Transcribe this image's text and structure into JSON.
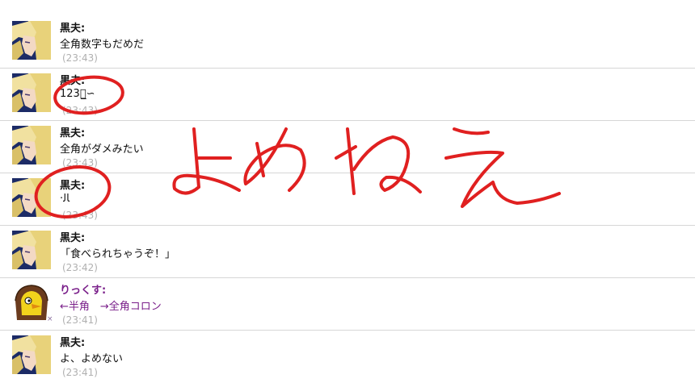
{
  "messages": [
    {
      "avatar": "blonde-boy-avatar",
      "name": "黒夫:",
      "text": "全角数字もだめだ",
      "time": "(23:43)"
    },
    {
      "avatar": "blonde-boy-avatar",
      "name": "黒夫:",
      "text": "123ﾑ̲∽",
      "time": "(23:43)"
    },
    {
      "avatar": "blonde-boy-avatar",
      "name": "黒夫:",
      "text": "全角がダメみたい",
      "time": "(23:43)"
    },
    {
      "avatar": "blonde-boy-avatar",
      "name": "黒夫:",
      "text": "·ﺎﻟ",
      "time": "(23:43)"
    },
    {
      "avatar": "blonde-boy-avatar",
      "name": "黒夫:",
      "text": "「食べられちゃうぞ！」",
      "time": "(23:42)"
    },
    {
      "avatar": "hooded-bird-avatar",
      "name": "りっくす:",
      "text": "←半角　→全角コロン",
      "time": "(23:41)",
      "badge": "×"
    },
    {
      "avatar": "blonde-boy-avatar",
      "name": "黒夫:",
      "text": "よ、よめない",
      "time": "(23:41)"
    }
  ],
  "annotation": {
    "handwritten_text": "よめねえ",
    "color": "#e02020"
  },
  "colors": {
    "separator": "#d6d6d6",
    "timestamp": "#b0b0b0",
    "other_user": "#7a1f8a"
  }
}
